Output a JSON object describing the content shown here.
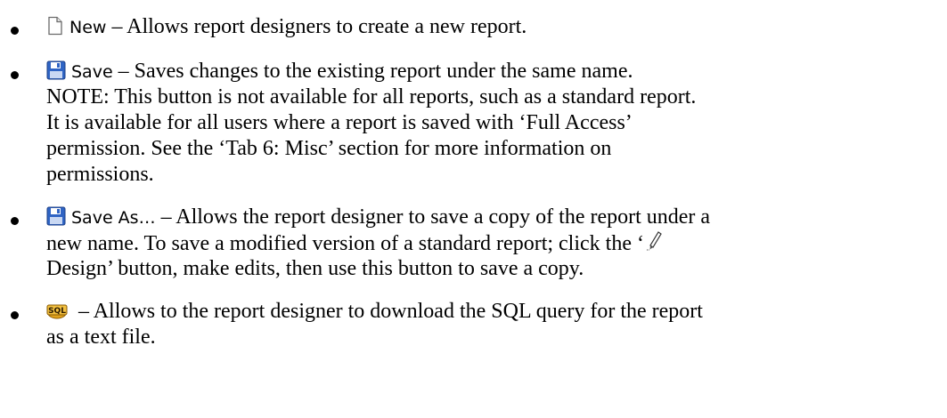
{
  "items": [
    {
      "icon": "new-document-icon",
      "label": "New",
      "dash": " – ",
      "text": "Allows report designers to create a new report."
    },
    {
      "icon": "save-floppy-icon",
      "label": "Save",
      "dash": " – ",
      "line1": "Saves changes to the existing report under the same name.",
      "line2": "NOTE:  This button is not available for all reports, such as a standard report.",
      "line3": "It is available for all users where a report is saved with ‘Full Access’",
      "line4": "permission.  See the ‘Tab 6: Misc’ section for more information on",
      "line5": "permissions."
    },
    {
      "icon": "save-as-floppy-icon",
      "label": "Save As…",
      "dash": " – ",
      "line1": "Allows the report designer to save a copy of the report under a",
      "line2": "new name.  To save a modified version of a standard report; click the ‘",
      "design_icon": "pencil-design-icon",
      "line3": "Design’ button, make edits, then use this button to save a copy."
    },
    {
      "icon": "sql-icon",
      "icon_text": "SQL",
      "dash": " – ",
      "line1": "Allows to the report designer to download the SQL query for the report",
      "line2": "as a text file."
    }
  ]
}
